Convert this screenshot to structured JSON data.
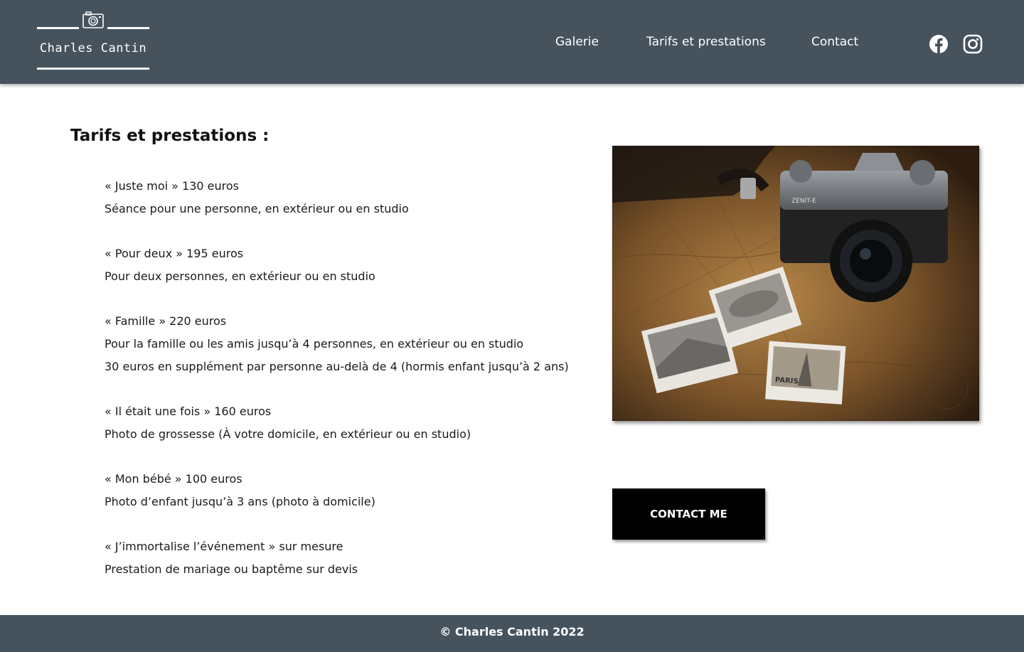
{
  "header": {
    "logo_text": "Charles Cantin",
    "nav": [
      {
        "label": "Galerie"
      },
      {
        "label": "Tarifs et prestations"
      },
      {
        "label": "Contact"
      }
    ],
    "social": [
      "facebook-icon",
      "instagram-icon"
    ]
  },
  "main": {
    "title": "Tarifs et prestations :",
    "offers": [
      {
        "title": "« Juste moi » 130 euros",
        "lines": [
          "Séance pour une personne, en extérieur ou en studio"
        ]
      },
      {
        "title": "« Pour deux » 195 euros",
        "lines": [
          "Pour deux personnes, en extérieur ou en studio"
        ]
      },
      {
        "title": "« Famille » 220 euros",
        "lines": [
          "Pour la famille ou les amis jusqu’à 4 personnes, en extérieur ou en studio",
          "30 euros en supplément par personne au-delà de 4 (hormis enfant jusqu’à 2 ans)"
        ]
      },
      {
        "title": "« Il était une fois » 160 euros",
        "lines": [
          "Photo de grossesse (À votre domicile, en extérieur ou en studio)"
        ]
      },
      {
        "title": "« Mon bébé » 100 euros",
        "lines": [
          "Photo d’enfant jusqu’à 3 ans (photo à domicile)"
        ]
      },
      {
        "title": "« J’immortalise l’événement » sur mesure",
        "lines": [
          "Prestation de mariage ou baptême sur devis"
        ]
      }
    ],
    "photo": {
      "camera_brand_text": "ZENIT-E",
      "polaroid_text": "PARIS"
    },
    "cta_label": "CONTACT ME"
  },
  "footer": {
    "copyright": "© Charles Cantin 2022"
  },
  "colors": {
    "header_bg": "#46535d",
    "footer_bg": "#46535d",
    "cta_bg": "#000000",
    "text": "#1a1a1a"
  }
}
